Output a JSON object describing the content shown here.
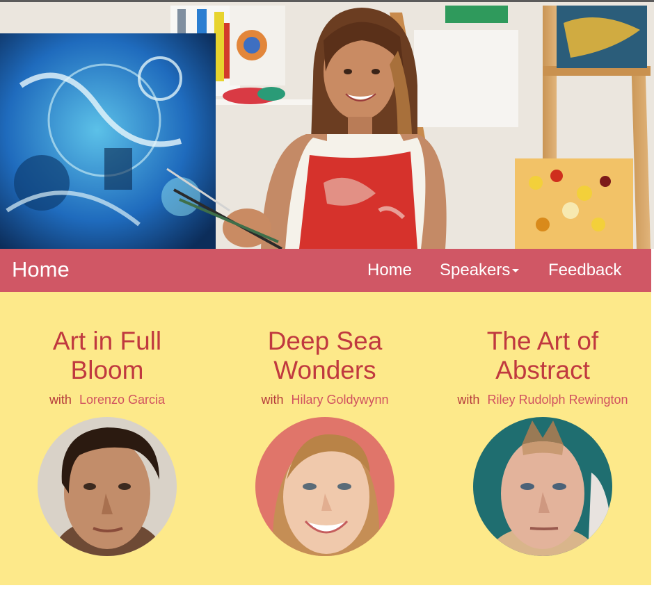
{
  "navbar": {
    "brand": "Home",
    "links": [
      {
        "label": "Home"
      },
      {
        "label": "Speakers",
        "has_dropdown": true
      },
      {
        "label": "Feedback"
      }
    ]
  },
  "sessions": [
    {
      "title_line1": "Art in Full",
      "title_line2": "Bloom",
      "with": "with",
      "speaker": "Lorenzo Garcia",
      "avatar": "speaker-portrait"
    },
    {
      "title_line1": "Deep Sea",
      "title_line2": "Wonders",
      "with": "with",
      "speaker": "Hilary Goldywynn",
      "avatar": "speaker-portrait"
    },
    {
      "title_line1": "The Art of",
      "title_line2": "Abstract",
      "with": "with",
      "speaker": "Riley Rudolph Rewington",
      "avatar": "speaker-portrait"
    }
  ],
  "colors": {
    "navbar": "#d05765",
    "band": "#fde98a",
    "title": "#c0393f",
    "link": "#d0515f"
  }
}
